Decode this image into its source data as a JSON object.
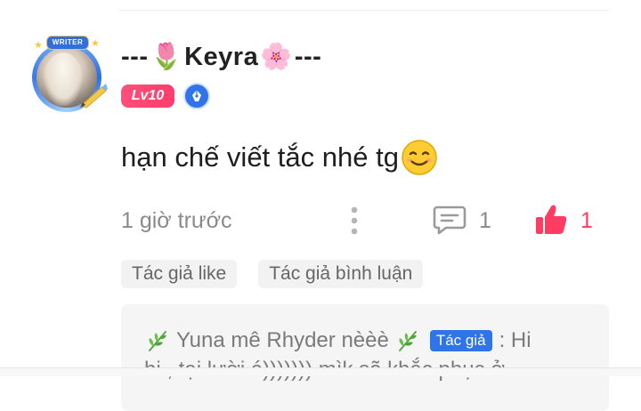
{
  "comment": {
    "author": {
      "name_prefix": "--- ",
      "name_core": "Keyra",
      "name_suffix": "---",
      "prefix_emoji": "🌷",
      "suffix_emoji": "🌸",
      "avatar_badge": "WRITER",
      "level": "Lv10"
    },
    "text": "hạn chế viết tắc nhé tg",
    "time": "1 giờ trước",
    "reply_count": "1",
    "like_count": "1",
    "tags": [
      "Tác giả like",
      "Tác giả bình luận"
    ]
  },
  "reply": {
    "author": "Yuna mê Rhyder nèèè",
    "author_tag": "Tác giả",
    "text_line1_end": ": Hi",
    "text_line2": "hi , tại lười á))))))) mìk sẽ khắc phục ở"
  },
  "icons": {
    "more": "vertical-dots-icon",
    "reply": "comment-bubble-icon",
    "like": "thumbs-up-icon",
    "author_badge": "pen-nib-icon",
    "emoji": "smiling-face-emoji",
    "leaf": "herb-icon"
  },
  "colors": {
    "accent_pink": "#ff3d62",
    "level_badge": "#ff4f7b",
    "author_blue": "#2f74e8",
    "muted_text": "#8a8a8a"
  }
}
